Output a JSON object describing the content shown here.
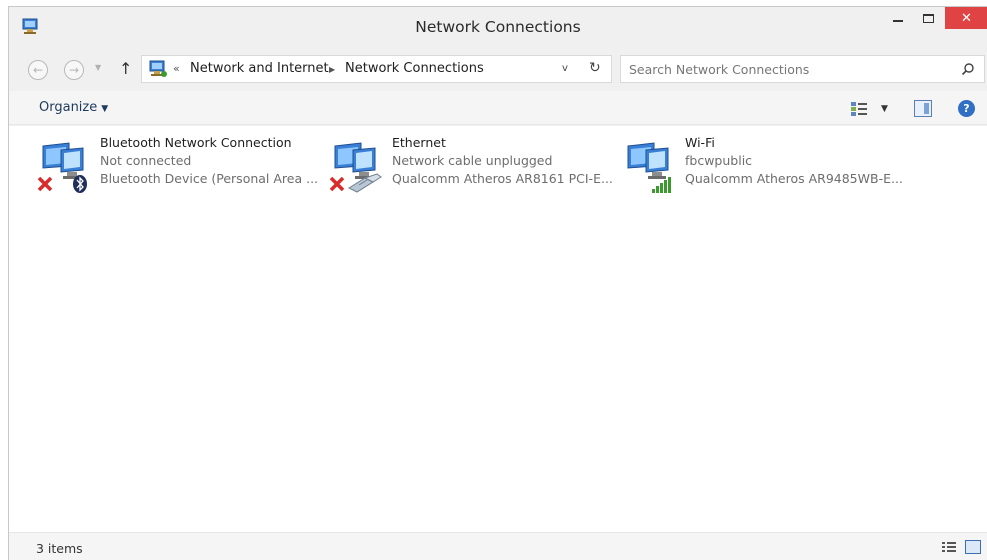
{
  "window": {
    "title": "Network Connections",
    "close_glyph": "✕"
  },
  "address": {
    "crumb_start_glyph": "«",
    "crumbs": [
      "Network and Internet",
      "Network Connections"
    ],
    "back_glyph": "←",
    "forward_glyph": "→",
    "up_glyph": "↑",
    "dropdown_glyph": "v",
    "refresh_glyph": "↻"
  },
  "search": {
    "placeholder": "Search Network Connections"
  },
  "toolbar": {
    "organize_label": "Organize",
    "help_glyph": "?"
  },
  "connections": [
    {
      "name": "Bluetooth Network Connection",
      "status": "Not connected",
      "device": "Bluetooth Device (Personal Area ...",
      "badge": "bluetooth-icon",
      "disconnected": true
    },
    {
      "name": "Ethernet",
      "status": "Network cable unplugged",
      "device": "Qualcomm Atheros AR8161 PCI-E...",
      "badge": "ethernet-cable-icon",
      "disconnected": true
    },
    {
      "name": "Wi-Fi",
      "status": "fbcwpublic",
      "device": "Qualcomm Atheros AR9485WB-E...",
      "badge": "signal-bars-icon",
      "disconnected": false
    }
  ],
  "statusbar": {
    "item_count": "3 items"
  },
  "colors": {
    "close_button": "#e04343",
    "link_blue": "#1e3a5c",
    "disconnect_red": "#d92b2b",
    "signal_green": "#3c9a2f"
  }
}
